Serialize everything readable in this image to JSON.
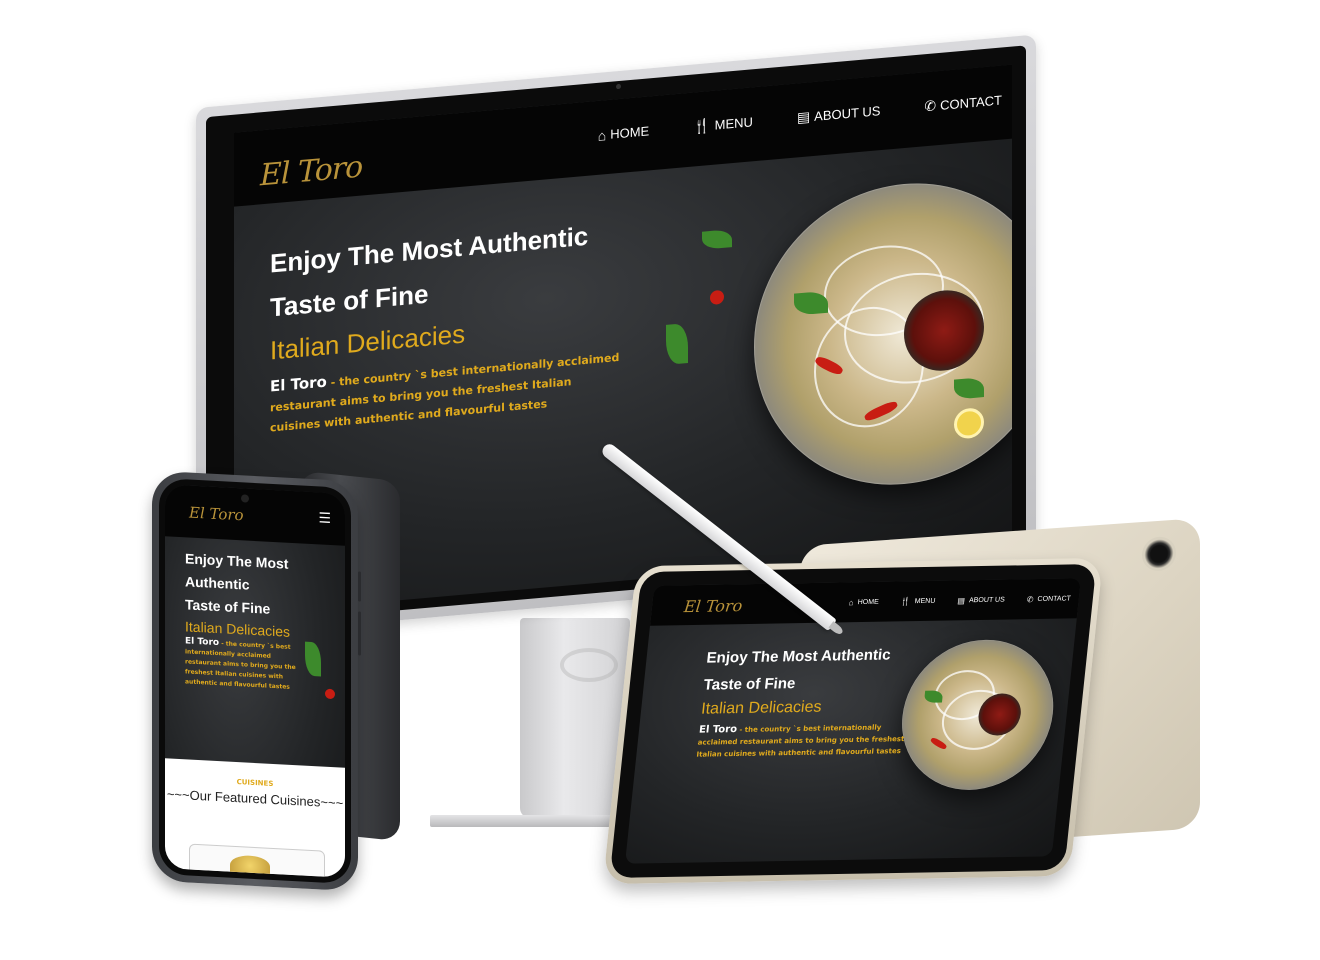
{
  "brand": {
    "logo_text": "El Toro",
    "accent_color": "#e0aa1d",
    "logo_color": "#b9933a",
    "nav_background": "#050505"
  },
  "nav": {
    "items": [
      {
        "label": "HOME",
        "icon": "home-icon",
        "glyph": "⌂"
      },
      {
        "label": "MENU",
        "icon": "utensils-icon",
        "glyph": "🍴"
      },
      {
        "label": "ABOUT US",
        "icon": "id-card-icon",
        "glyph": "▤"
      },
      {
        "label": "CONTACT",
        "icon": "phone-icon",
        "glyph": "✆"
      }
    ],
    "mobile_menu_icon": "hamburger-icon",
    "mobile_menu_glyph": "☰"
  },
  "hero": {
    "desktop_title_line1": "Enjoy The Most Authentic",
    "desktop_title_line2": "Taste of Fine",
    "phone_title_line1": "Enjoy The Most",
    "phone_title_line2": "Authentic",
    "phone_title_line3": "Taste of Fine",
    "subtitle": "Italian Delicacies",
    "brand_name": "El Toro",
    "description": " - the country `s best internationally acclaimed restaurant aims to bring you the freshest Italian cuisines with authentic and flavourful tastes"
  },
  "cuisines": {
    "tag": "CUISINES",
    "title": "~~~Our Featured Cuisines~~~"
  }
}
